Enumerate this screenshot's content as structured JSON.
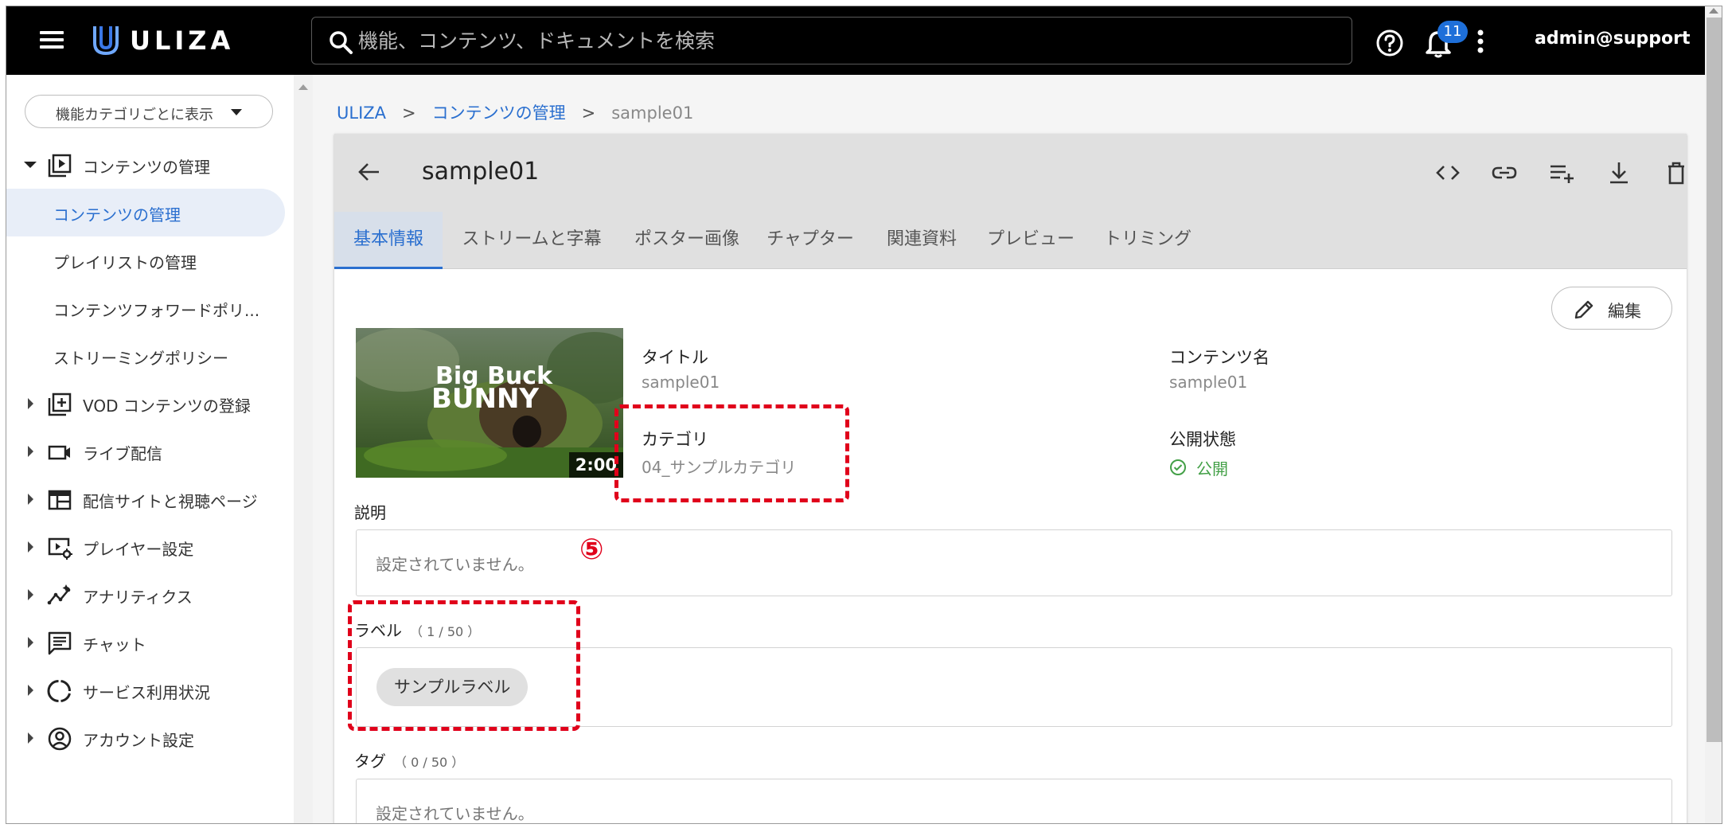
{
  "header": {
    "logo_text": "ULIZA",
    "search_placeholder": "機能、コンテンツ、ドキュメントを検索",
    "notification_count": "11",
    "user": "admin@support"
  },
  "sidebar": {
    "category_toggle": "機能カテゴリごとに表示",
    "items": [
      {
        "label": "コンテンツの管理",
        "icon": "content-library-icon",
        "expanded": true
      },
      {
        "label": "VOD コンテンツの登録",
        "icon": "add-box-icon"
      },
      {
        "label": "ライブ配信",
        "icon": "video-camera-icon"
      },
      {
        "label": "配信サイトと視聴ページ",
        "icon": "web-page-icon"
      },
      {
        "label": "プレイヤー設定",
        "icon": "player-settings-icon"
      },
      {
        "label": "アナリティクス",
        "icon": "analytics-icon"
      },
      {
        "label": "チャット",
        "icon": "chat-icon"
      },
      {
        "label": "サービス利用状況",
        "icon": "usage-icon"
      },
      {
        "label": "アカウント設定",
        "icon": "account-icon"
      }
    ],
    "subitems": [
      {
        "label": "コンテンツの管理",
        "active": true
      },
      {
        "label": "プレイリストの管理"
      },
      {
        "label": "コンテンツフォワードポリ..."
      },
      {
        "label": "ストリーミングポリシー"
      }
    ]
  },
  "breadcrumb": {
    "items": [
      "ULIZA",
      "コンテンツの管理",
      "sample01"
    ],
    "separator": ">"
  },
  "content": {
    "title": "sample01",
    "tabs": [
      "基本情報",
      "ストリームと字幕",
      "ポスター画像",
      "チャプター",
      "関連資料",
      "プレビュー",
      "トリミング"
    ],
    "active_tab": "基本情報",
    "edit_label": "編集",
    "thumbnail_duration": "2:00",
    "thumbnail_title": "Big Buck BUNNY",
    "fields": {
      "title_label": "タイトル",
      "title_value": "sample01",
      "content_name_label": "コンテンツ名",
      "content_name_value": "sample01",
      "category_label": "カテゴリ",
      "category_value": "04_サンプルカテゴリ",
      "status_label": "公開状態",
      "status_value": "公開"
    },
    "description": {
      "label": "説明",
      "value": "設定されていません。"
    },
    "labels": {
      "label": "ラベル",
      "count": "（ 1 / 50 ）",
      "chips": [
        "サンプルラベル"
      ]
    },
    "tags": {
      "label": "タグ",
      "count": "（ 0 / 50 ）",
      "value": "設定されていません。"
    }
  },
  "annotation": {
    "marker": "⑤"
  },
  "colors": {
    "header_bg": "#000000",
    "accent": "#2a6fcf",
    "status_green": "#43a047",
    "annotation_red": "#e0001b",
    "badge_blue": "#1e6fd9"
  }
}
